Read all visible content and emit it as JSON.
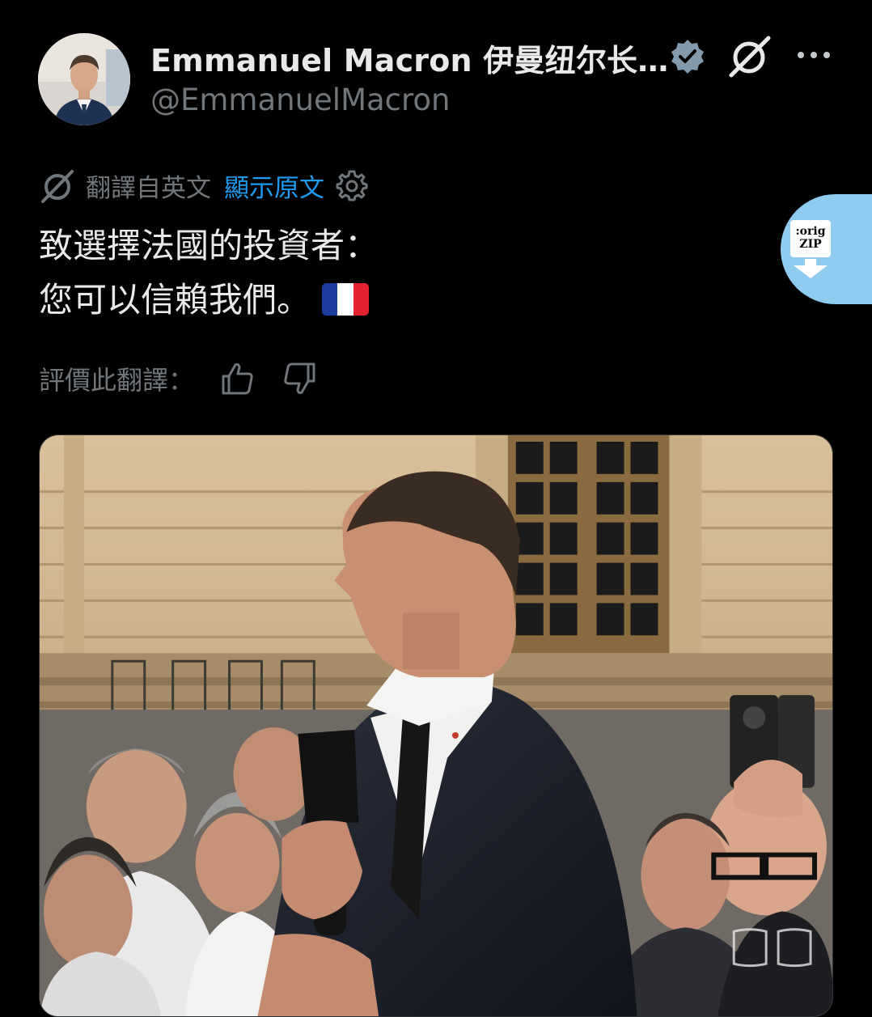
{
  "tweet": {
    "display_name": "Emmanuel Macron 伊曼纽尔长…",
    "handle": "@EmmanuelMacron",
    "translation_label": "翻譯自英文",
    "show_original": "顯示原文",
    "text_line1": "致選擇法國的投資者：",
    "text_line2": "您可以信賴我們。",
    "rate_label": "評價此翻譯："
  },
  "zip_button": {
    "line1": ":orig",
    "line2": "ZIP"
  },
  "colors": {
    "background": "#000000",
    "text": "#e7e9ea",
    "muted": "#71767b",
    "link": "#1d9bf0",
    "zip_button": "#8ecbee"
  },
  "icons": [
    "verified-badge-icon",
    "grok-icon",
    "more-icon",
    "translate-icon",
    "gear-icon",
    "thumbs-up-icon",
    "thumbs-down-icon",
    "france-flag-icon"
  ]
}
